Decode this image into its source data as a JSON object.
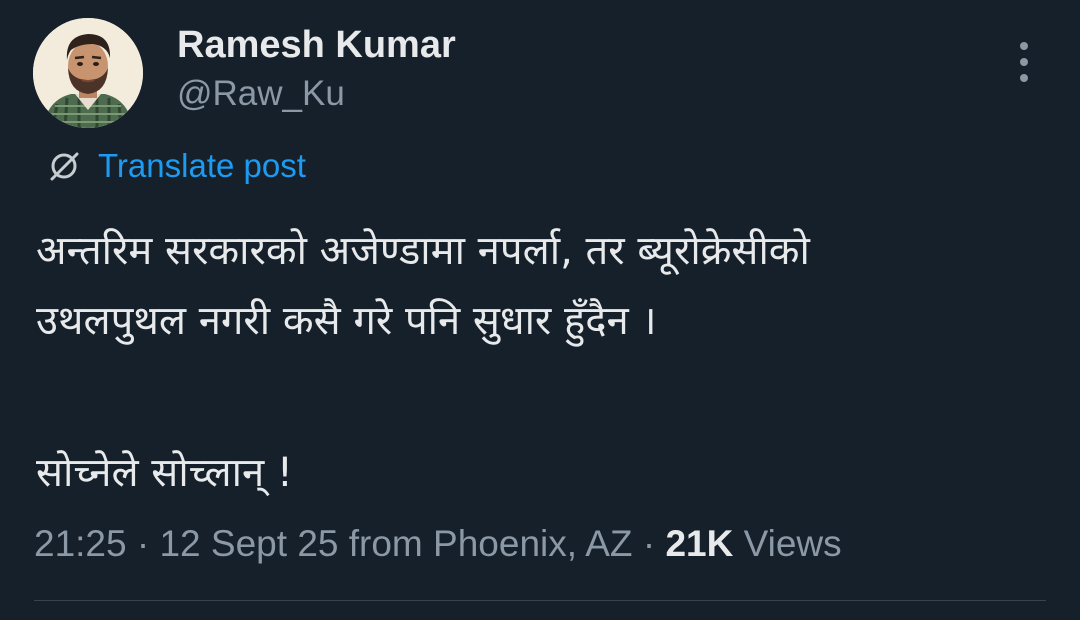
{
  "author": {
    "name": "Ramesh Kumar",
    "handle": "@Raw_Ku",
    "avatar_icon": "profile-avatar"
  },
  "more_icon": "more-vertical-icon",
  "translate": {
    "icon": "translate-globe-icon",
    "label": "Translate post"
  },
  "post": {
    "lines": [
      "अन्तरिम सरकारको अजेण्डामा नपर्ला, तर ब्यूरोक्रेसीको",
      "उथलपुथल नगरी कसै गरे पनि सुधार हुँदैन ।",
      "सोच्नेले सोच्लान् !"
    ]
  },
  "meta": {
    "time": "21:25",
    "separator": " · ",
    "date": "12 Sept 25",
    "location_text": " from Phoenix, AZ",
    "views_count": "21K",
    "views_label": " Views"
  },
  "colors": {
    "background": "#15202b",
    "text_primary": "#e7e9ea",
    "text_secondary": "#8b98a5",
    "accent": "#1d9bf0",
    "divider": "#38444d"
  }
}
